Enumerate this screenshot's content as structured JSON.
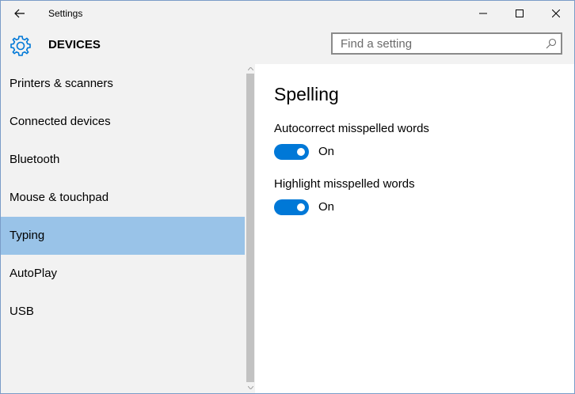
{
  "window": {
    "title": "Settings"
  },
  "header": {
    "section_title": "DEVICES",
    "search_placeholder": "Find a setting",
    "search_value": ""
  },
  "sidebar": {
    "items": [
      {
        "label": "Printers & scanners",
        "selected": false
      },
      {
        "label": "Connected devices",
        "selected": false
      },
      {
        "label": "Bluetooth",
        "selected": false
      },
      {
        "label": "Mouse & touchpad",
        "selected": false
      },
      {
        "label": "Typing",
        "selected": true
      },
      {
        "label": "AutoPlay",
        "selected": false
      },
      {
        "label": "USB",
        "selected": false
      }
    ]
  },
  "content": {
    "title": "Spelling",
    "settings": [
      {
        "label": "Autocorrect misspelled words",
        "state": "On"
      },
      {
        "label": "Highlight misspelled words",
        "state": "On"
      }
    ]
  },
  "colors": {
    "accent": "#0078d7",
    "selected_bg": "#99c3e8",
    "chrome_bg": "#f2f2f2"
  },
  "icons": {
    "back": "back-arrow-icon",
    "gear": "gear-icon",
    "search": "search-icon",
    "minimize": "minimize-icon",
    "maximize": "maximize-icon",
    "close": "close-icon"
  }
}
